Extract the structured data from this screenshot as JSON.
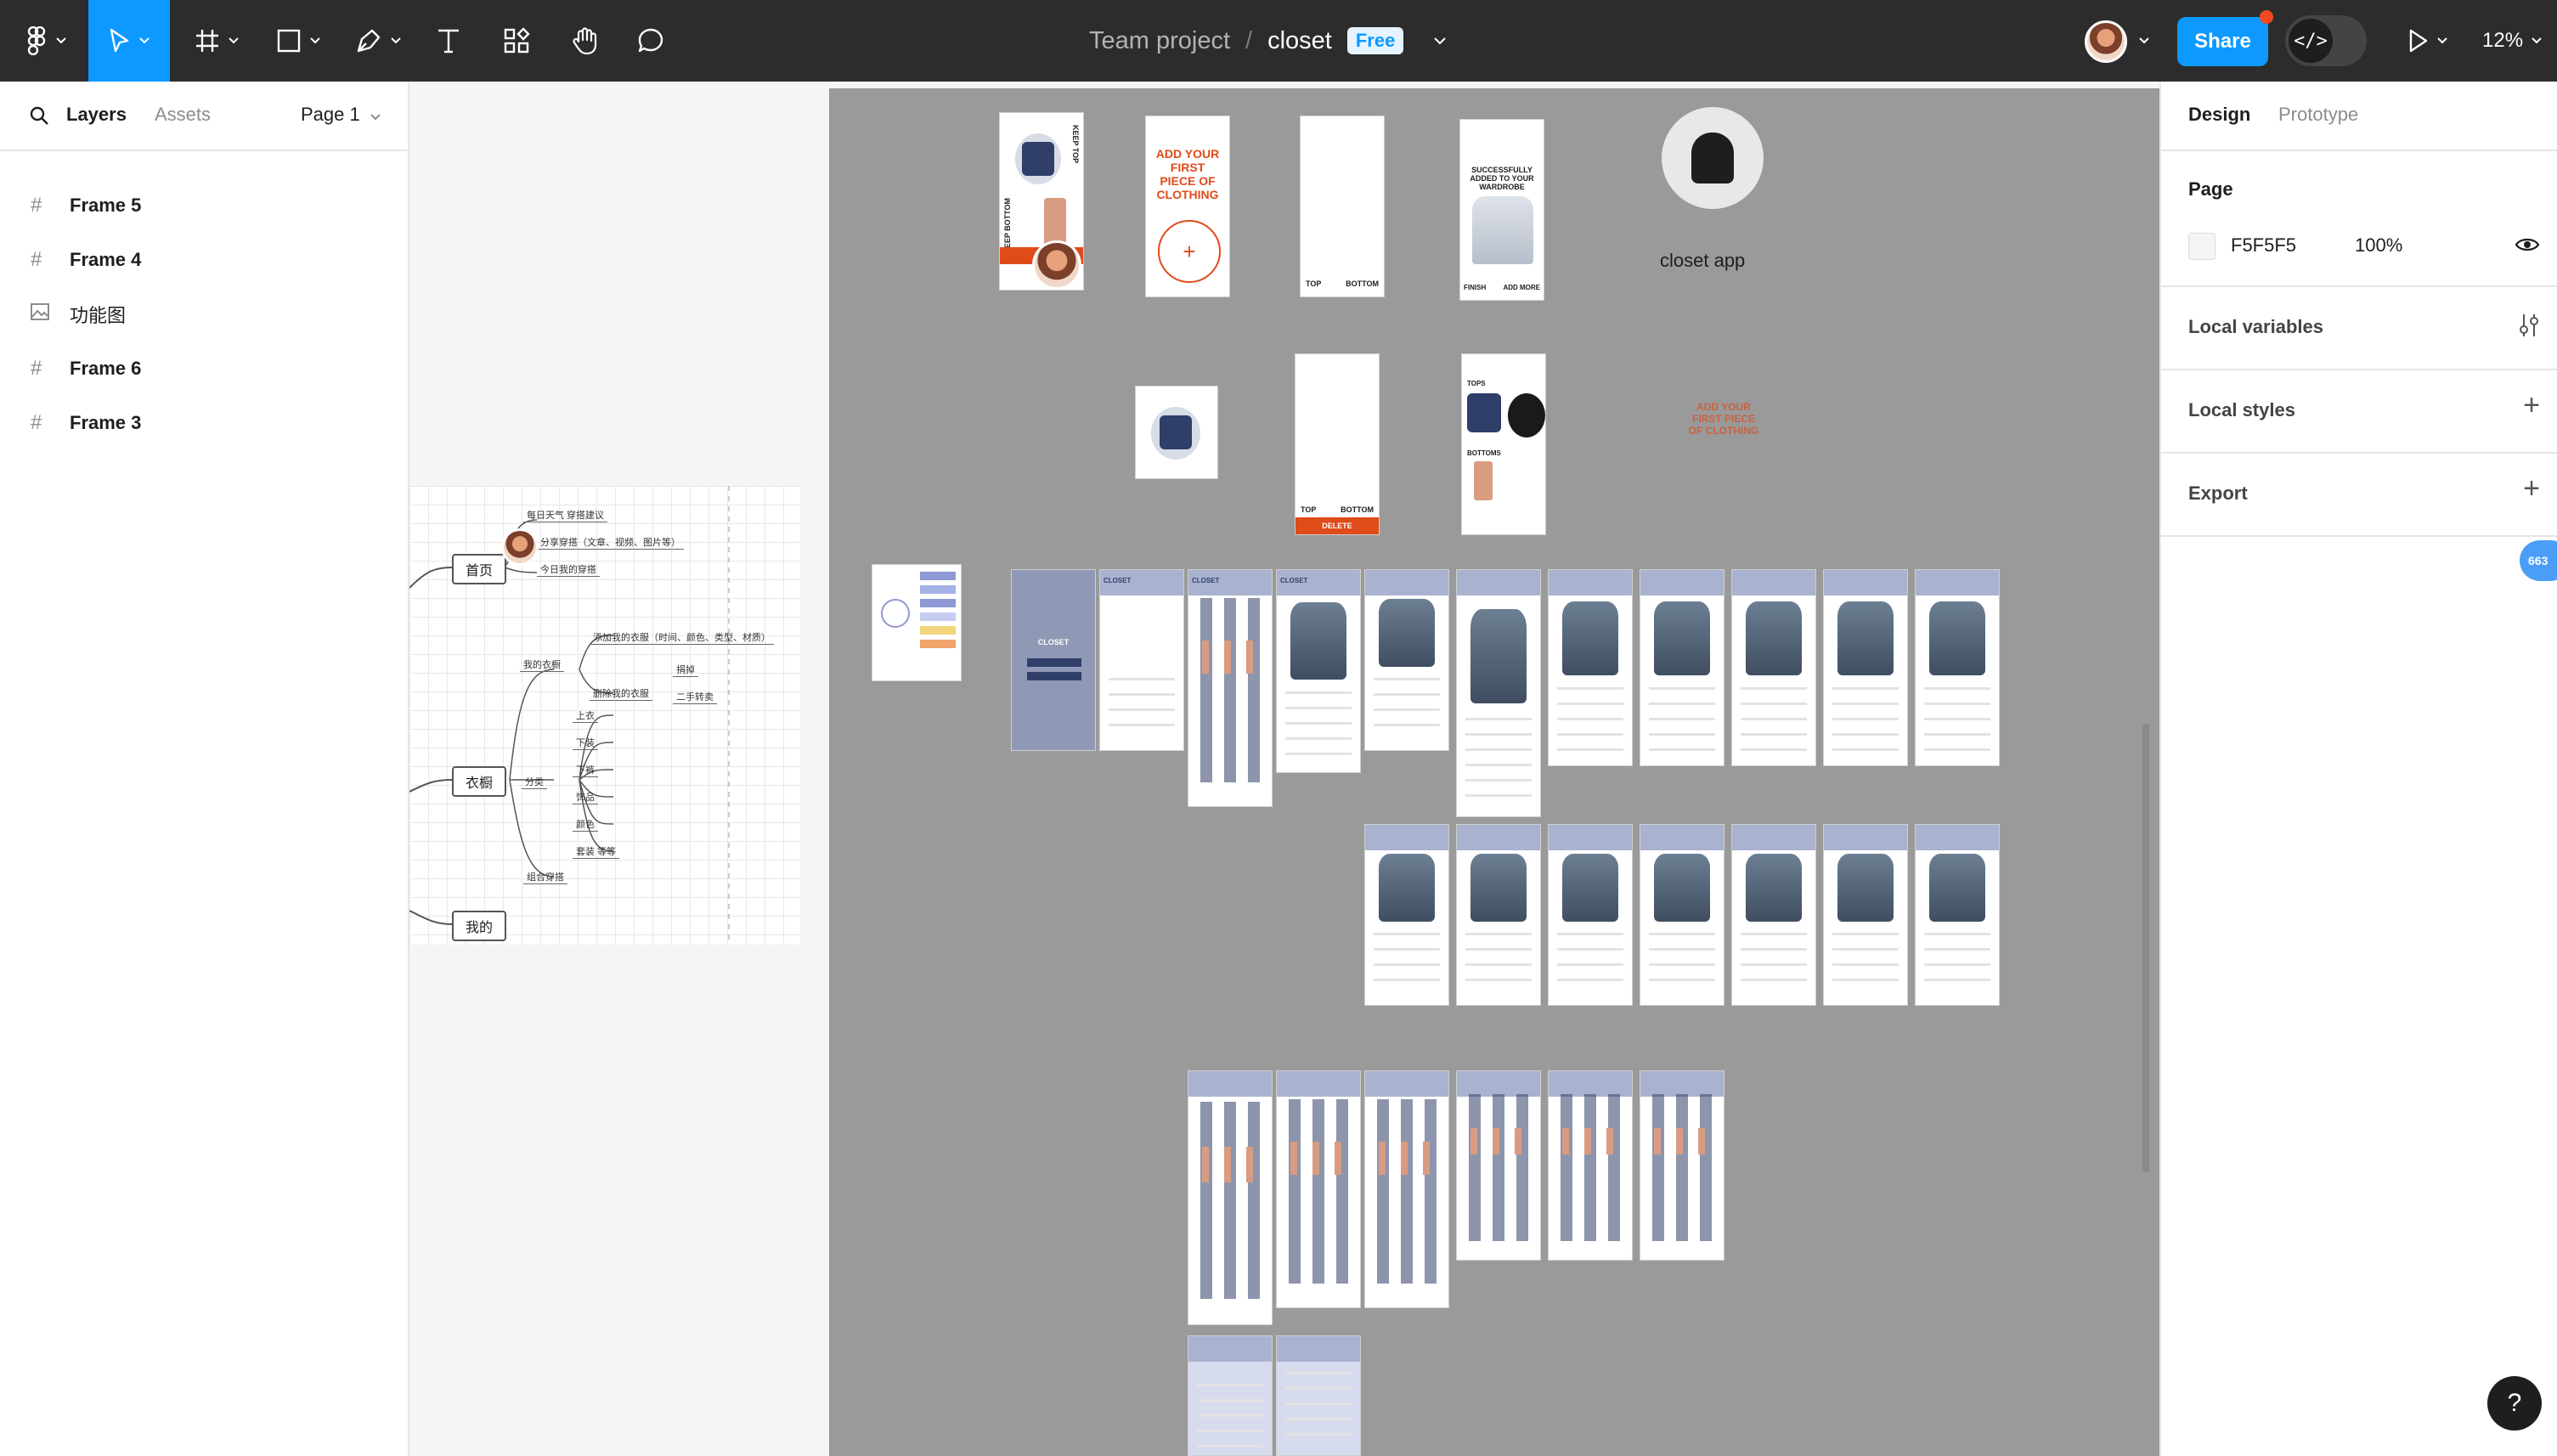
{
  "toolbar": {
    "project": "Team project",
    "separator": "/",
    "file_name": "closet",
    "plan_badge": "Free",
    "share_label": "Share",
    "dev_mode_glyph": "</>",
    "zoom_level": "12%",
    "accent_color": "#0d99ff"
  },
  "left_panel": {
    "tab_layers": "Layers",
    "tab_assets": "Assets",
    "page_selector": "Page 1",
    "layers": [
      {
        "name": "Frame 5",
        "type": "frame"
      },
      {
        "name": "Frame 4",
        "type": "frame"
      },
      {
        "name": "功能图",
        "type": "image"
      },
      {
        "name": "Frame 6",
        "type": "frame"
      },
      {
        "name": "Frame 3",
        "type": "frame"
      }
    ]
  },
  "right_panel": {
    "tab_design": "Design",
    "tab_prototype": "Prototype",
    "page_heading": "Page",
    "page_color": "F5F5F5",
    "page_opacity": "100%",
    "local_variables": "Local variables",
    "local_styles": "Local styles",
    "export": "Export"
  },
  "canvas": {
    "app_title": "closet app",
    "add_first_1": "ADD YOUR FIRST PIECE OF CLOTHING",
    "add_first_2": "ADD YOUR FIRST PIECE OF CLOTHING",
    "success_text": "SUCCESSFULLY ADDED TO YOUR WARDROBE",
    "finish": "FINISH",
    "add_more": "ADD MORE",
    "top": "TOP",
    "bottom": "BOTTOM",
    "delete": "DELETE",
    "tops": "TOPS",
    "bottoms": "BOTTOMS",
    "keep_top": "KEEP TOP",
    "keep_bottom": "KEEP BOTTOM",
    "closet": "CLOSET",
    "mindmap": {
      "home": "首页",
      "wardrobe": "衣橱",
      "mine": "我的",
      "leaf_weather": "每日天气  穿搭建议",
      "leaf_share": "分享穿搭（文章、视频、图片等）",
      "leaf_today": "今日我的穿搭",
      "leaf_my_clothes": "我的衣橱",
      "leaf_add": "添加我的衣服（时间、颜色、类型、材质）",
      "leaf_delete": "删除我的衣服",
      "leaf_donate": "捐掉",
      "leaf_second": "二手转卖",
      "leaf_top": "上衣",
      "leaf_pants": "下装",
      "leaf_skirt": "下裤",
      "leaf_accessory": "饰品",
      "leaf_color": "颜色",
      "leaf_season": "套装 等等",
      "leaf_category": "分类",
      "leaf_combo": "组合穿搭"
    }
  },
  "collaborator_badge": "663",
  "help_glyph": "?"
}
